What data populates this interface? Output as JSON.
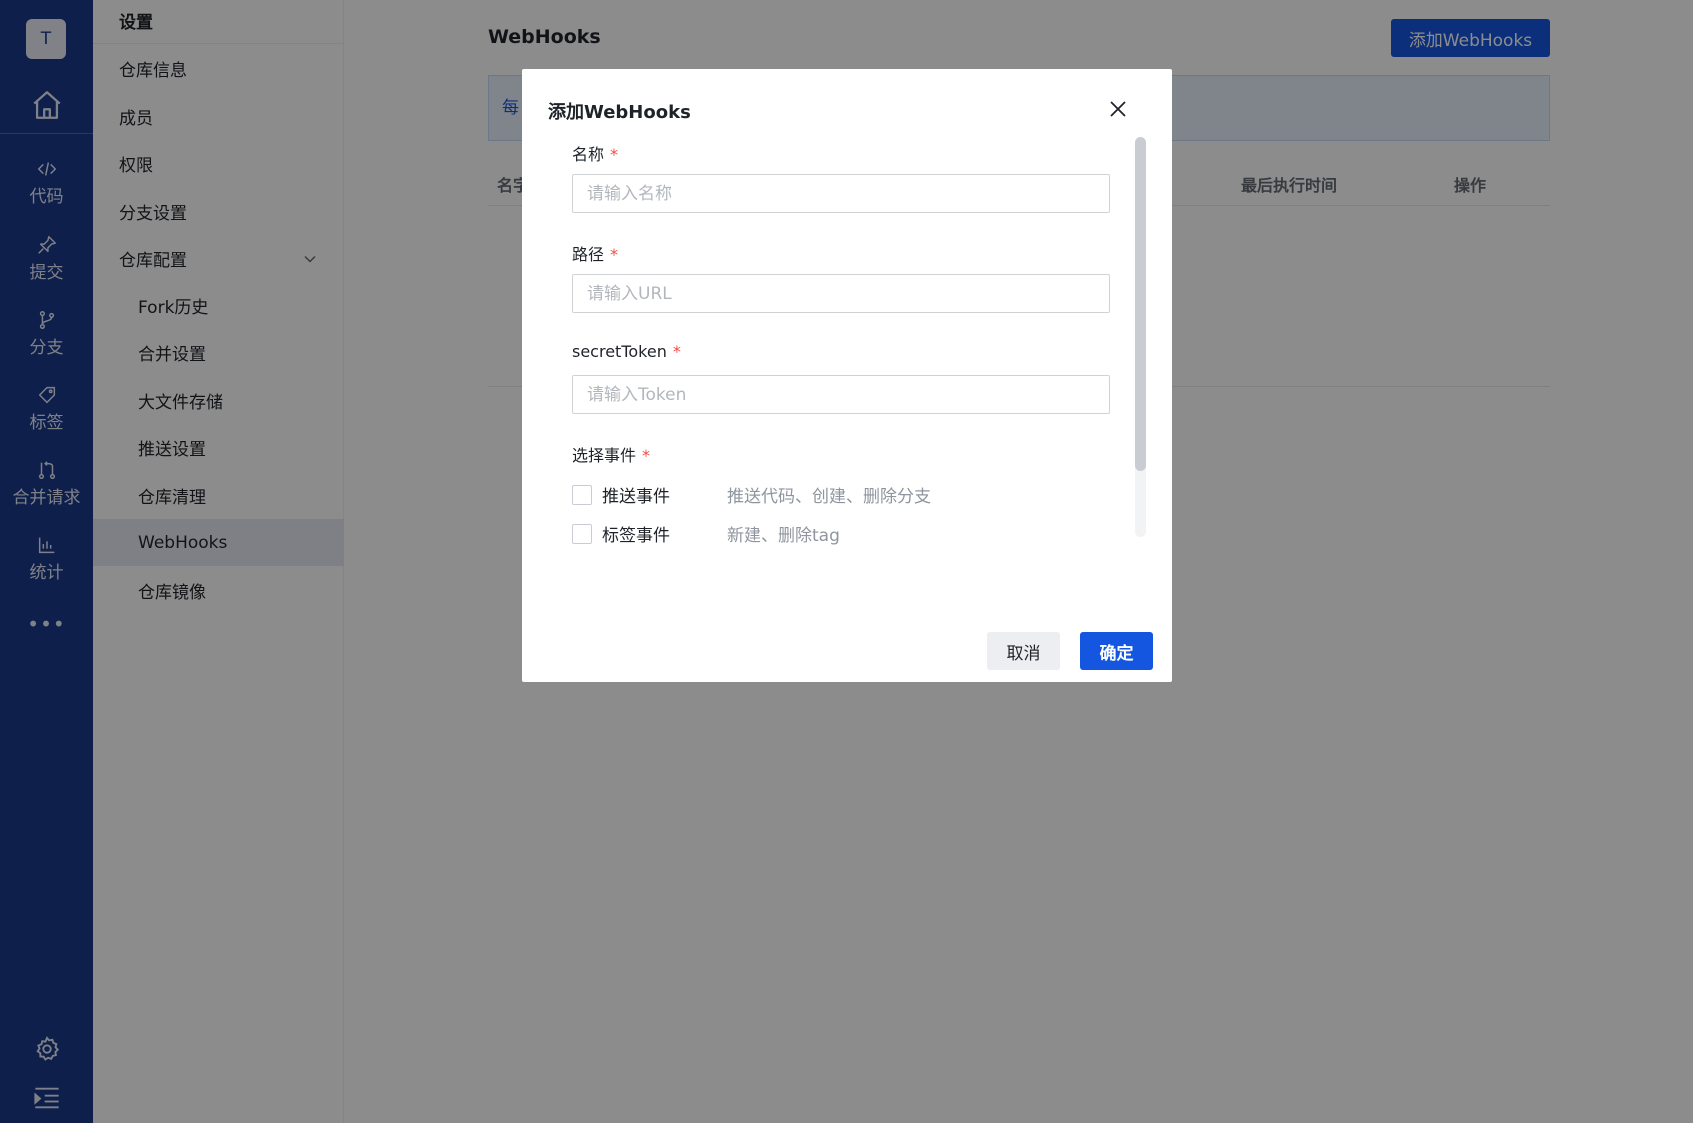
{
  "rail": {
    "avatar_letter": "T",
    "items": [
      {
        "label": "代码",
        "icon": "code-icon"
      },
      {
        "label": "提交",
        "icon": "pin-icon"
      },
      {
        "label": "分支",
        "icon": "branch-icon"
      },
      {
        "label": "标签",
        "icon": "tag-icon"
      },
      {
        "label": "合并请求",
        "icon": "merge-request-icon"
      },
      {
        "label": "统计",
        "icon": "stats-icon"
      }
    ],
    "more": "•••"
  },
  "settings": {
    "title": "设置",
    "items": [
      "仓库信息",
      "成员",
      "权限",
      "分支设置",
      "仓库配置"
    ],
    "sub_items": [
      "Fork历史",
      "合并设置",
      "大文件存储",
      "推送设置",
      "仓库清理",
      "WebHooks",
      "仓库镜像"
    ],
    "active": "WebHooks"
  },
  "main": {
    "title": "WebHooks",
    "add_button": "添加WebHooks",
    "info_text": "每",
    "columns": {
      "name": "名字",
      "last_exec": "最后执行时间",
      "actions": "操作"
    }
  },
  "modal": {
    "title": "添加WebHooks",
    "required_mark": "*",
    "fields": {
      "name": {
        "label": "名称",
        "placeholder": "请输入名称",
        "value": ""
      },
      "path": {
        "label": "路径",
        "placeholder": "请输入URL",
        "value": ""
      },
      "token": {
        "label": "secretToken",
        "placeholder": "请输入Token",
        "value": ""
      }
    },
    "events_label": "选择事件",
    "events": [
      {
        "label": "推送事件",
        "desc": "推送代码、创建、删除分支",
        "checked": false
      },
      {
        "label": "标签事件",
        "desc": "新建、删除tag",
        "checked": false
      }
    ],
    "cancel": "取消",
    "confirm": "确定"
  },
  "colors": {
    "rail_bg": "#1d3a8a",
    "primary": "#1456e0",
    "required": "#f54a45"
  }
}
